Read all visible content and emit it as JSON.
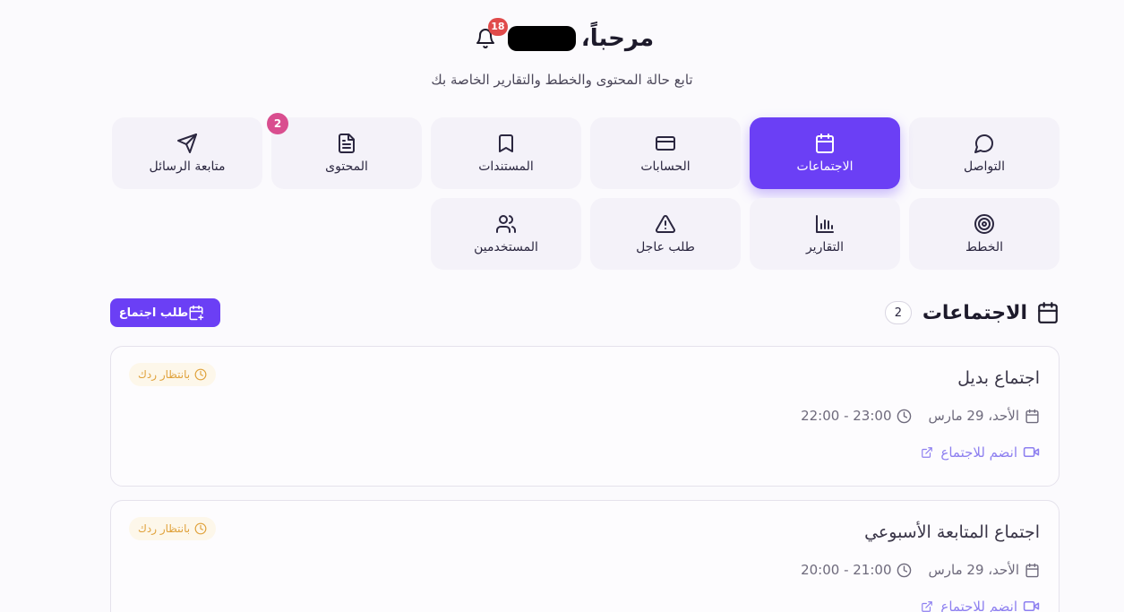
{
  "header": {
    "greeting": "مرحباً،",
    "notification_count": "18",
    "subtitle": "تابع حالة المحتوى والخطط والتقارير الخاصة بك"
  },
  "tiles": [
    {
      "label": "التواصل",
      "icon": "message-circle-icon"
    },
    {
      "label": "الاجتماعات",
      "icon": "calendar-icon",
      "active": true
    },
    {
      "label": "الحسابات",
      "icon": "credit-card-icon"
    },
    {
      "label": "المستندات",
      "icon": "bookmark-icon"
    },
    {
      "label": "المحتوى",
      "icon": "file-text-icon",
      "badge": "2"
    },
    {
      "label": "متابعة الرسائل",
      "icon": "send-icon"
    },
    {
      "label": "الخطط",
      "icon": "target-icon"
    },
    {
      "label": "التقارير",
      "icon": "bar-chart-icon"
    },
    {
      "label": "طلب عاجل",
      "icon": "alert-triangle-icon"
    },
    {
      "label": "المستخدمين",
      "icon": "users-icon"
    }
  ],
  "meetings_section": {
    "title": "الاجتماعات",
    "count": "2",
    "request_button": "طلب اجتماع"
  },
  "meetings": [
    {
      "title": "اجتماع بديل",
      "date": "الأحد، 29 مارس",
      "time": "22:00 - 23:00",
      "join_label": "انضم للاجتماع",
      "status": "بانتظار ردك"
    },
    {
      "title": "اجتماع المتابعة الأسبوعي",
      "date": "الأحد، 29 مارس",
      "time": "20:00 - 21:00",
      "join_label": "انضم للاجتماع",
      "status": "بانتظار ردك"
    }
  ],
  "colors": {
    "accent": "#6b3ff5",
    "badge_red": "#e04a4a",
    "badge_pink": "#d94e8f",
    "status_text": "#e0a23c",
    "link": "#8d7ff0"
  }
}
